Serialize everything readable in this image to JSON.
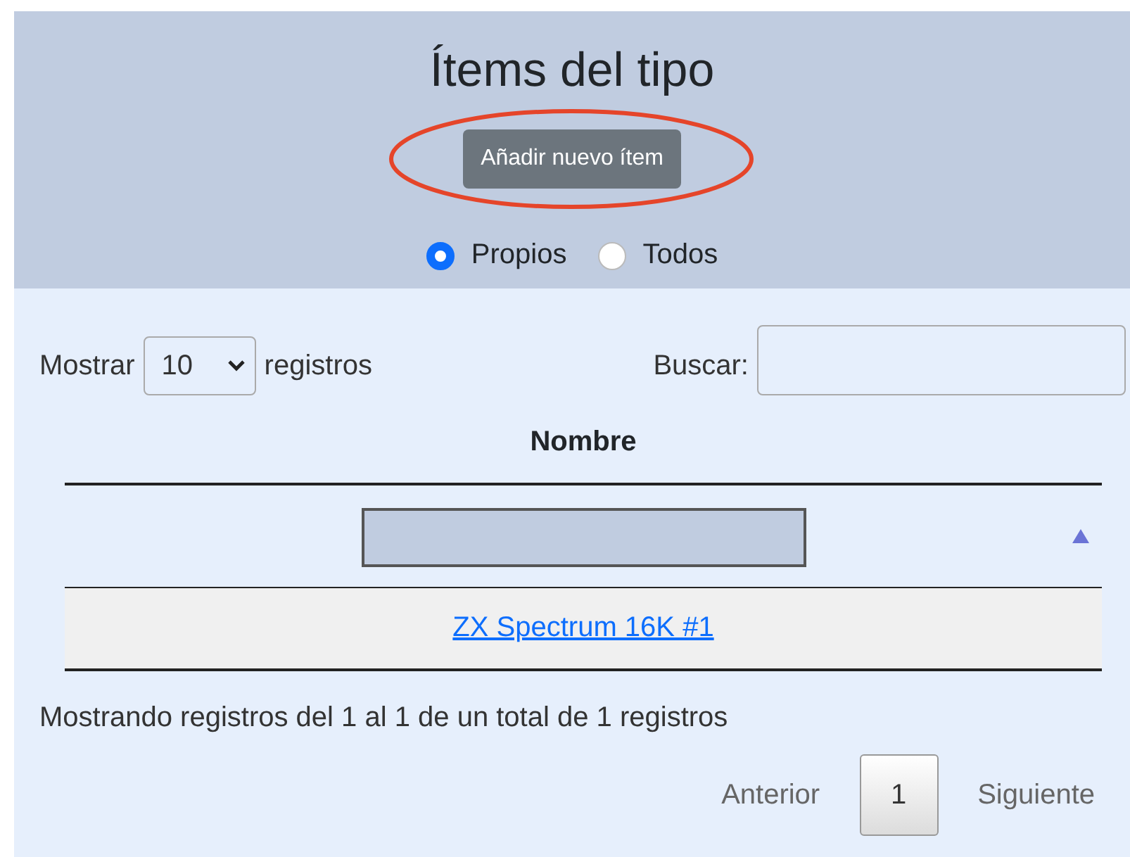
{
  "header": {
    "title": "Ítems del tipo",
    "add_button": "Añadir nuevo ítem",
    "annotated": true,
    "filters": [
      {
        "label": "Propios",
        "selected": true
      },
      {
        "label": "Todos",
        "selected": false
      }
    ]
  },
  "controls": {
    "length_prefix": "Mostrar",
    "length_value": "10",
    "length_suffix": "registros",
    "search_label": "Buscar:"
  },
  "table": {
    "columns": [
      {
        "label": "Nombre",
        "sort_ascending": true
      }
    ],
    "rows": [
      {
        "cells": [
          "ZX Spectrum 16K #1"
        ]
      }
    ]
  },
  "info": "Mostrando registros del 1 al 1 de un total de 1 registros",
  "pagination": {
    "previous": "Anterior",
    "pages": [
      {
        "label": "1",
        "selected": true
      }
    ],
    "next": "Siguiente"
  }
}
